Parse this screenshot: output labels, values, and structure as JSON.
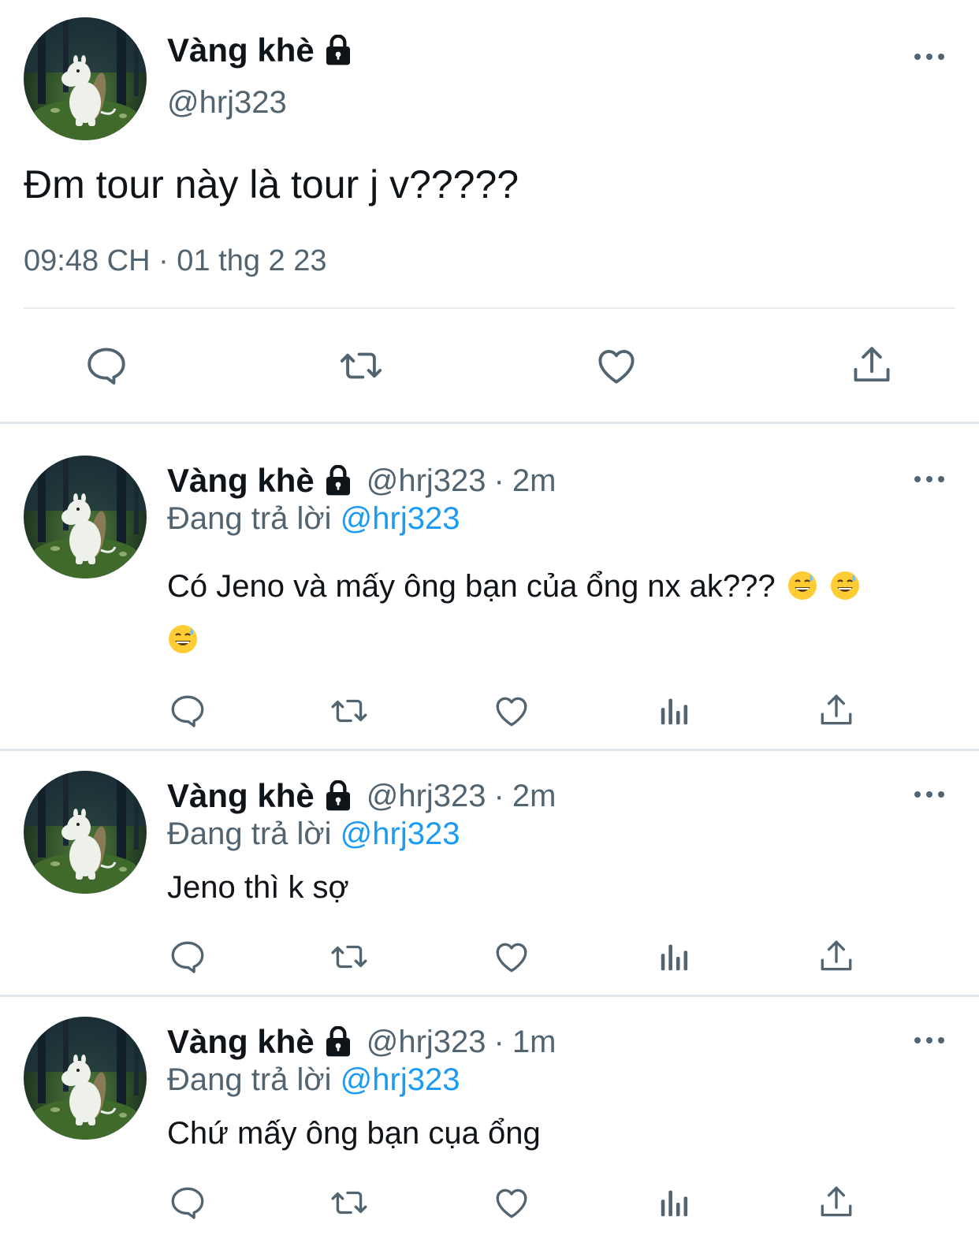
{
  "main_tweet": {
    "display_name": "Vàng khè",
    "handle": "@hrj323",
    "text": "Đm tour này là tour j v?????",
    "timestamp": "09:48 CH · 01 thg 2 23",
    "protected_icon": "lock-icon",
    "more_icon": "more-horizontal-icon",
    "actions": [
      "reply-icon",
      "retweet-icon",
      "like-icon",
      "share-icon"
    ]
  },
  "replies": [
    {
      "display_name": "Vàng khè",
      "handle": "@hrj323",
      "separator": "·",
      "time": "2m",
      "replying_to_label": "Đang trả lời",
      "replying_to_handle": "@hrj323",
      "text": "Có Jeno và mấy ông bạn của ổng nx ak???",
      "emoji": [
        "grinning-sweat-emoji",
        "grinning-sweat-emoji",
        "grinning-sweat-emoji"
      ]
    },
    {
      "display_name": "Vàng khè",
      "handle": "@hrj323",
      "separator": "·",
      "time": "2m",
      "replying_to_label": "Đang trả lời",
      "replying_to_handle": "@hrj323",
      "text": "Jeno thì k sợ",
      "emoji": []
    },
    {
      "display_name": "Vàng khè",
      "handle": "@hrj323",
      "separator": "·",
      "time": "1m",
      "replying_to_label": "Đang trả lời",
      "replying_to_handle": "@hrj323",
      "text": "Chứ mấy ông bạn cụa ổng",
      "emoji": []
    }
  ],
  "reply_actions": [
    "reply-icon",
    "retweet-icon",
    "like-icon",
    "views-icon",
    "share-icon"
  ],
  "colors": {
    "text_primary": "#0f1419",
    "text_secondary": "#536471",
    "mention": "#1d9bf0",
    "divider": "#e6ecf0"
  }
}
